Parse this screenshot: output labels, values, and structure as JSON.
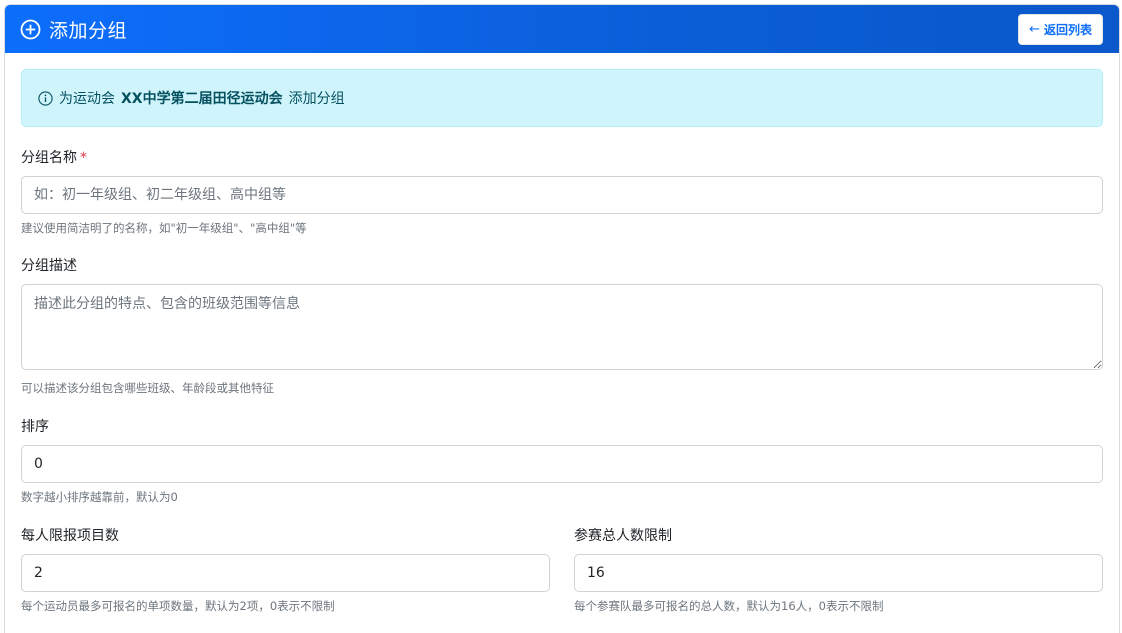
{
  "header": {
    "title": "添加分组",
    "back_label": "返回列表",
    "back_arrow": "←"
  },
  "alert": {
    "prefix": "为运动会",
    "meet_name": "XX中学第二届田径运动会",
    "suffix": "添加分组"
  },
  "form": {
    "name": {
      "label": "分组名称",
      "required_mark": "*",
      "placeholder": "如：初一年级组、初二年级组、高中组等",
      "value": "",
      "hint": "建议使用简洁明了的名称，如\"初一年级组\"、\"高中组\"等"
    },
    "description": {
      "label": "分组描述",
      "placeholder": "描述此分组的特点、包含的班级范围等信息",
      "value": "",
      "hint": "可以描述该分组包含哪些班级、年龄段或其他特征"
    },
    "sort": {
      "label": "排序",
      "value": "0",
      "hint": "数字越小排序越靠前，默认为0"
    },
    "per_person_limit": {
      "label": "每人限报项目数",
      "value": "2",
      "hint": "每个运动员最多可报名的单项数量，默认为2项，0表示不限制"
    },
    "total_limit": {
      "label": "参赛总人数限制",
      "value": "16",
      "hint": "每个参赛队最多可报名的总人数，默认为16人，0表示不限制"
    }
  },
  "colors": {
    "primary": "#0d6efd",
    "alert_bg": "#cff4fc",
    "alert_text": "#055160",
    "required": "#dc3545"
  }
}
